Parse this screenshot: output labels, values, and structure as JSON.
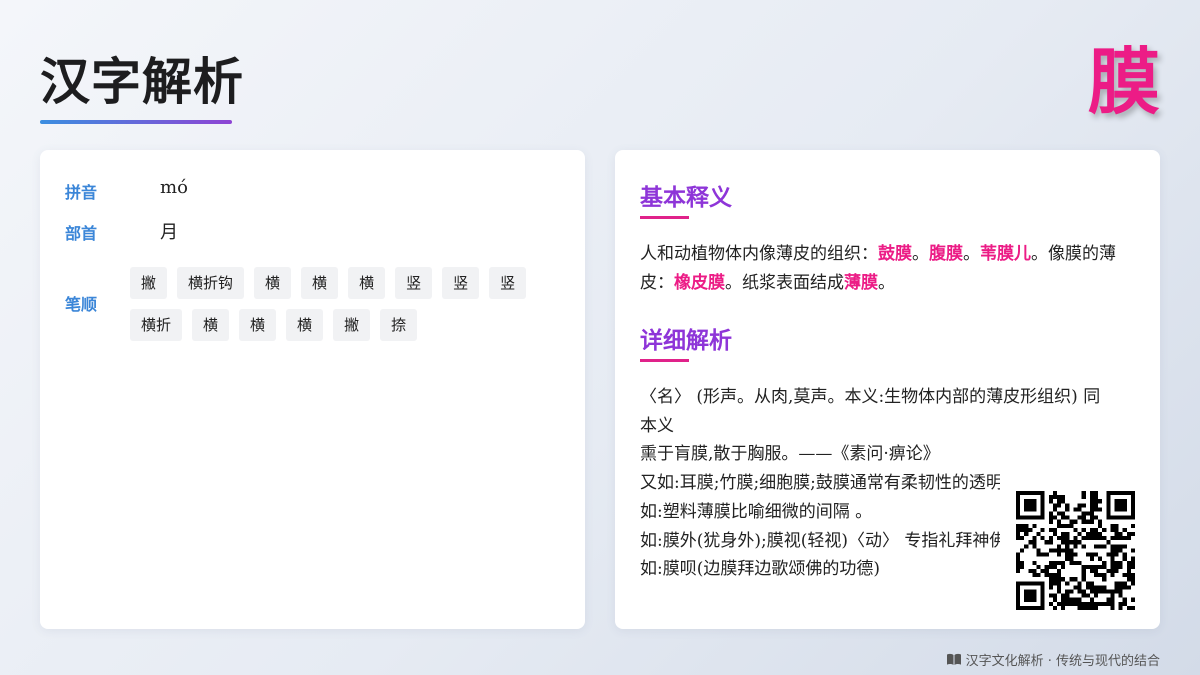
{
  "header": {
    "title": "汉字解析",
    "character": "膜"
  },
  "info": {
    "pinyin_label": "拼音",
    "pinyin": "mó",
    "radical_label": "部首",
    "radical": "月",
    "strokes_label": "笔顺",
    "strokes_row1": [
      "撇",
      "横折钩",
      "横",
      "横",
      "横",
      "竖",
      "竖",
      "竖"
    ],
    "strokes_row2": [
      "横折",
      "横",
      "横",
      "横",
      "撇",
      "捺"
    ]
  },
  "basic": {
    "title": "基本释义",
    "p1_a": "人和动植物体内像薄皮的组织：",
    "p1_h1": "鼓膜",
    "p1_s1": "。",
    "p1_h2": "腹膜",
    "p1_s2": "。",
    "p1_h3": "苇膜儿",
    "p1_b": "。像膜的薄皮：",
    "p1_h4": "橡皮膜",
    "p1_c": "。纸浆表面结成",
    "p1_h5": "薄膜",
    "p1_d": "。"
  },
  "detail": {
    "title": "详细解析",
    "lines": [
      "〈名〉 (形声。从肉,莫声。本义:生物体内部的薄皮形组织) 同",
      "本义",
      "熏于肓膜,散于胸服。——《素问·痹论》",
      "又如:耳膜;竹膜;细胞膜;鼓膜通常有柔韧性的透明薄层",
      "如:塑料薄膜比喻细微的间隔 。",
      "如:膜外(犹身外);膜视(轻视)〈动〉 专指礼拜神佛,相当于拜",
      "如:膜呗(边膜拜边歌颂佛的功德)"
    ]
  },
  "footer": {
    "text": "汉字文化解析 · 传统与现代的结合",
    "icon": "book-icon"
  },
  "colors": {
    "accent_pink": "#ec1c86",
    "accent_purple": "#8e35d8",
    "accent_blue": "#3b86d8"
  }
}
